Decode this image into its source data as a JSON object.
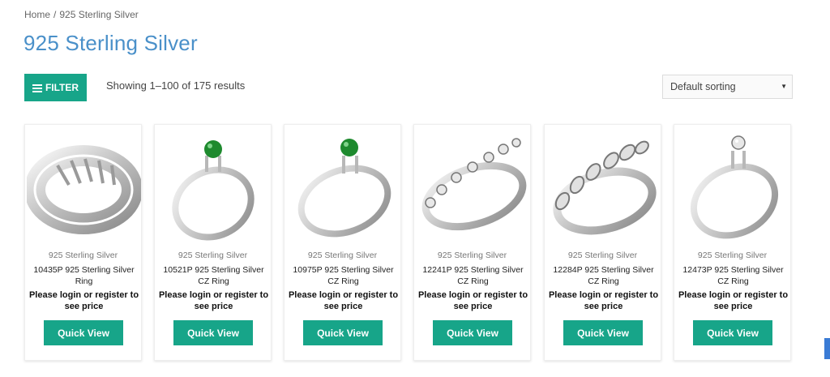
{
  "breadcrumb": {
    "home": "Home",
    "separator": "/",
    "current": "925 Sterling Silver"
  },
  "page": {
    "title": "925 Sterling Silver"
  },
  "toolbar": {
    "filter_label": "FILTER",
    "result_count": "Showing 1–100 of 175 results",
    "sort_selected": "Default sorting"
  },
  "products": [
    {
      "category": "925 Sterling Silver",
      "name": "10435P 925 Sterling Silver Ring",
      "price_note": "Please login or register to see price",
      "quick_view": "Quick View",
      "stone": "none"
    },
    {
      "category": "925 Sterling Silver",
      "name": "10521P 925 Sterling Silver CZ Ring",
      "price_note": "Please login or register to see price",
      "quick_view": "Quick View",
      "stone": "green"
    },
    {
      "category": "925 Sterling Silver",
      "name": "10975P 925 Sterling Silver CZ Ring",
      "price_note": "Please login or register to see price",
      "quick_view": "Quick View",
      "stone": "green"
    },
    {
      "category": "925 Sterling Silver",
      "name": "12241P 925 Sterling Silver CZ Ring",
      "price_note": "Please login or register to see price",
      "quick_view": "Quick View",
      "stone": "clear"
    },
    {
      "category": "925 Sterling Silver",
      "name": "12284P 925 Sterling Silver CZ Ring",
      "price_note": "Please login or register to see price",
      "quick_view": "Quick View",
      "stone": "clear"
    },
    {
      "category": "925 Sterling Silver",
      "name": "12473P 925 Sterling Silver CZ Ring",
      "price_note": "Please login or register to see price",
      "quick_view": "Quick View",
      "stone": "clear"
    }
  ],
  "colors": {
    "accent": "#17a589",
    "title": "#4a90c9",
    "green_stone": "#1e8a2e",
    "silver": "#c8c8c8"
  }
}
